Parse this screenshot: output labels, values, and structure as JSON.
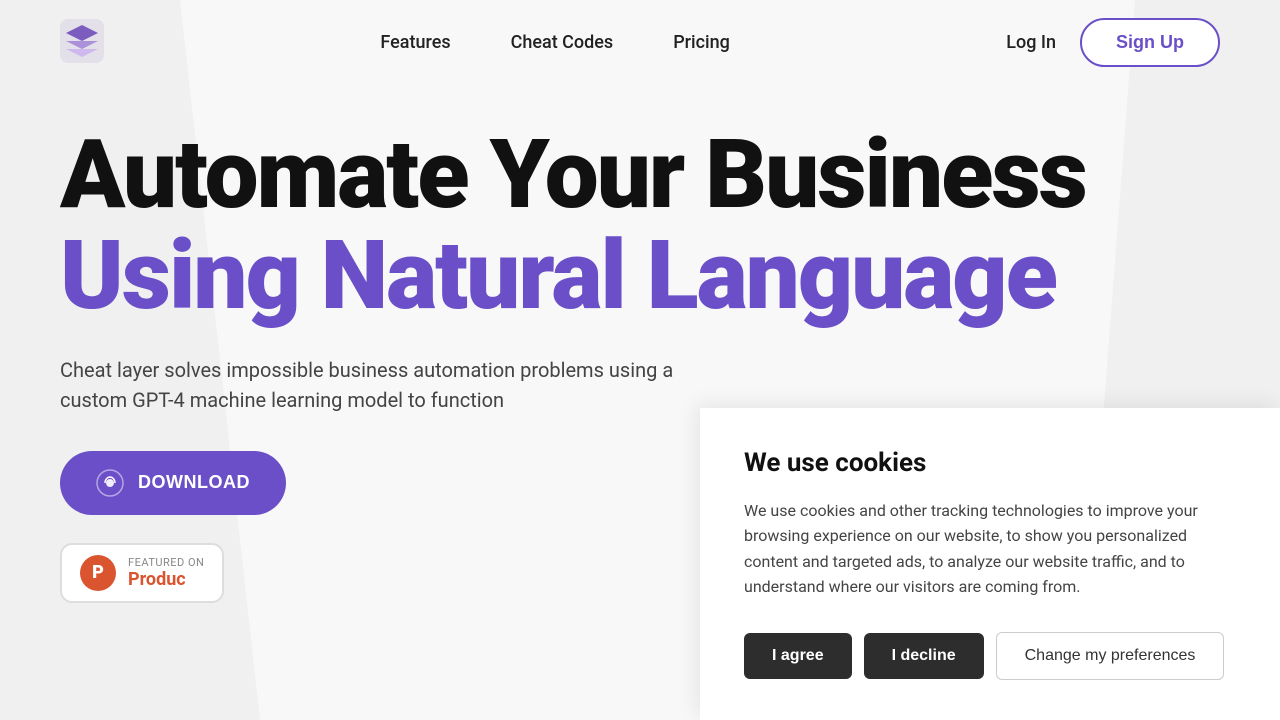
{
  "navbar": {
    "logo_alt": "Cheat Layer Logo",
    "links": [
      {
        "label": "Features",
        "id": "features"
      },
      {
        "label": "Cheat Codes",
        "id": "cheat-codes"
      },
      {
        "label": "Pricing",
        "id": "pricing"
      }
    ],
    "login_label": "Log In",
    "signup_label": "Sign Up"
  },
  "hero": {
    "title_line1": "Automate Your Business",
    "title_line2": "Using Natural Language",
    "subtitle": "Cheat layer solves impossible business automation problems using a custom GPT-4 machine learning model to function",
    "cta_label": "DOWNLOAD",
    "product_hunt": {
      "featured_label": "FEATURED ON",
      "name": "Produc"
    }
  },
  "cookie": {
    "title": "We use cookies",
    "body": "We use cookies and other tracking technologies to improve your browsing experience on our website, to show you personalized content and targeted ads, to analyze our website traffic, and to understand where our visitors are coming from.",
    "agree_label": "I agree",
    "decline_label": "I decline",
    "preferences_label": "Change my preferences"
  },
  "colors": {
    "purple": "#6a4fc8",
    "dark": "#111111",
    "product_hunt_orange": "#da552f"
  }
}
